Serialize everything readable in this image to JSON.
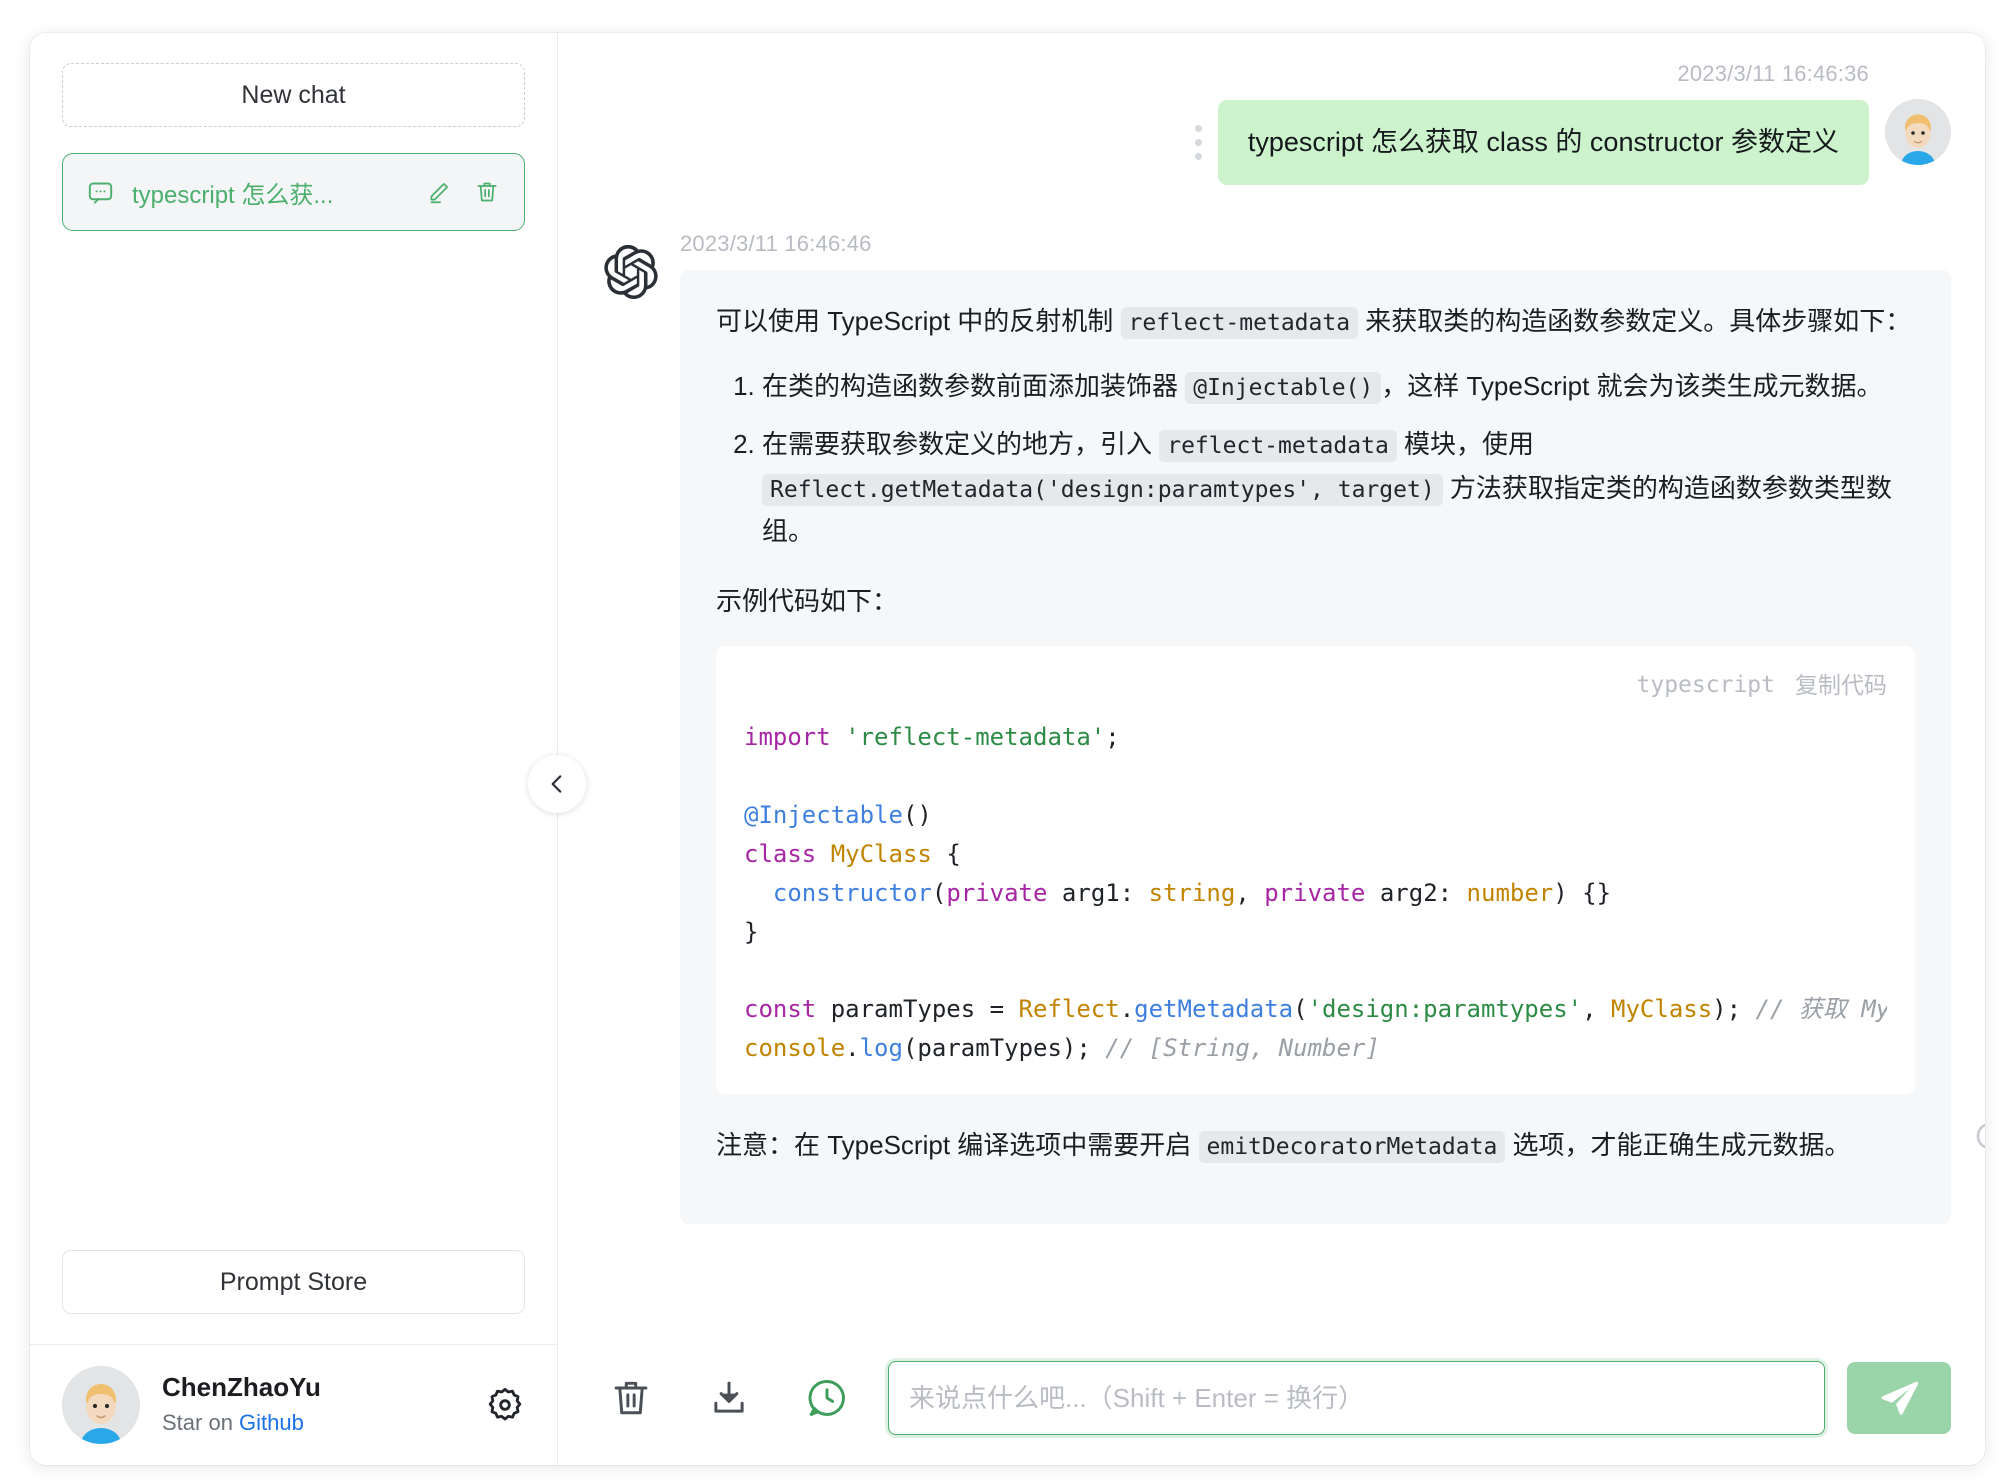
{
  "sidebar": {
    "new_chat_label": "New chat",
    "chat_items": [
      {
        "title": "typescript 怎么获...",
        "icon": "message-icon",
        "edit_icon": "pencil-icon",
        "delete_icon": "trash-icon",
        "active": true,
        "accent_color": "#4caf6d"
      }
    ],
    "prompt_store_label": "Prompt Store",
    "footer": {
      "user_name": "ChenZhaoYu",
      "star_prefix": "Star on ",
      "github_link": "Github",
      "settings_icon": "gear-icon",
      "avatar_icon": "user-avatar"
    },
    "collapse_icon": "chevron-left-icon"
  },
  "conversation": {
    "user_message": {
      "timestamp": "2023/3/11 16:46:36",
      "text": "typescript 怎么获取 class 的 constructor 参数定义",
      "menu_icon": "more-vertical-icon",
      "avatar_icon": "user-avatar",
      "bubble_color": "#ccf3cc"
    },
    "bot_message": {
      "timestamp": "2023/3/11 16:46:46",
      "logo_icon": "openai-logo-icon",
      "paragraph_1_a": "可以使用 TypeScript 中的反射机制 ",
      "paragraph_1_code": "reflect-metadata",
      "paragraph_1_b": " 来获取类的构造函数参数定义。具体步骤如下：",
      "steps": [
        {
          "a": "在类的构造函数参数前面添加装饰器 ",
          "code": "@Injectable()",
          "b": "，这样 TypeScript 就会为该类生成元数据。"
        },
        {
          "a": "在需要获取参数定义的地方，引入 ",
          "code": "reflect-metadata",
          "b": " 模块，使用 ",
          "code2": "Reflect.getMetadata('design:paramtypes', target)",
          "c": " 方法获取指定类的构造函数参数类型数组。"
        }
      ],
      "example_label": "示例代码如下：",
      "code_block": {
        "language": "typescript",
        "copy_label": "复制代码",
        "lines": [
          "import 'reflect-metadata';",
          "",
          "@Injectable()",
          "class MyClass {",
          "  constructor(private arg1: string, private arg2: number) {}",
          "}",
          "",
          "const paramTypes = Reflect.getMetadata('design:paramtypes', MyClass); // 获取 MyClass 构造函数参数类型",
          "console.log(paramTypes); // [String, Number]"
        ]
      },
      "note_a": "注意：在 TypeScript 编译选项中需要开启 ",
      "note_code": "emitDecoratorMetadata",
      "note_b": " 选项，才能正确生成元数据。",
      "regenerate_icon": "refresh-icon",
      "menu_icon": "more-vertical-icon",
      "bubble_color": "#f5f7f9"
    }
  },
  "composer": {
    "clear_icon": "trash-icon",
    "export_icon": "download-icon",
    "history_icon": "chat-clock-icon",
    "input_value": "",
    "input_placeholder": "来说点什么吧...（Shift + Enter = 换行）",
    "send_icon": "send-icon",
    "send_color": "#9ad4a9",
    "accent_color": "#4caf6d"
  }
}
